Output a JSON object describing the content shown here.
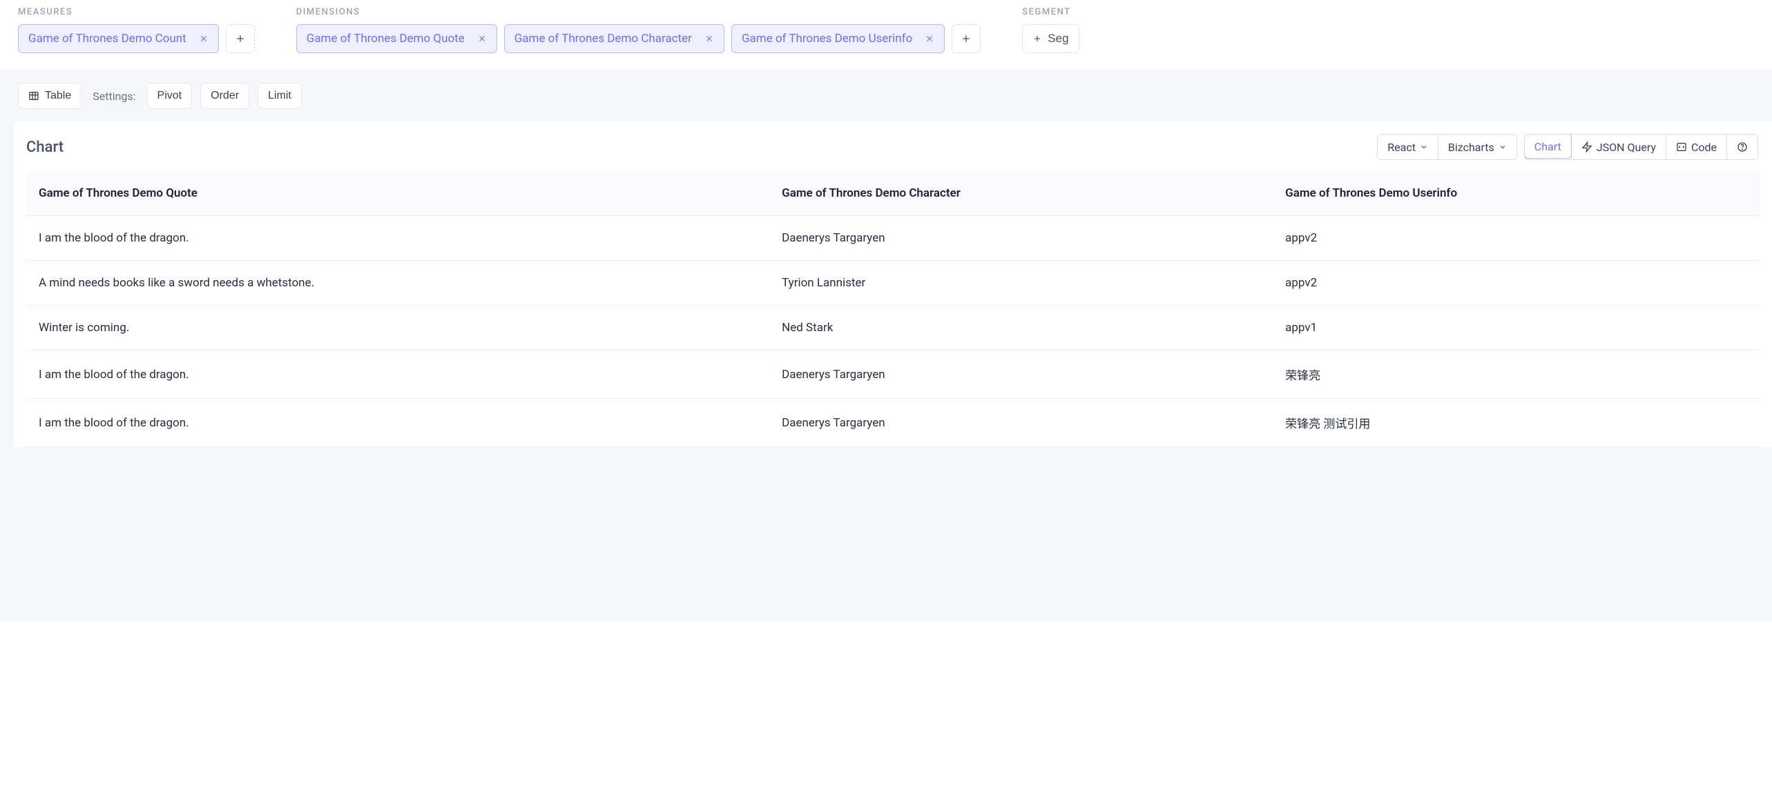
{
  "measures": {
    "label": "MEASURES",
    "chips": [
      "Game of Thrones Demo Count"
    ]
  },
  "dimensions": {
    "label": "DIMENSIONS",
    "chips": [
      "Game of Thrones Demo Quote",
      "Game of Thrones Demo Character",
      "Game of Thrones Demo Userinfo"
    ]
  },
  "segment": {
    "label": "SEGMENT",
    "add_label": "Seg"
  },
  "toolbar": {
    "table": "Table",
    "settings_label": "Settings:",
    "pivot": "Pivot",
    "order": "Order",
    "limit": "Limit"
  },
  "panel": {
    "title": "Chart",
    "framework": "React",
    "chartlib": "Bizcharts",
    "view_chart": "Chart",
    "view_json": "JSON Query",
    "view_code": "Code"
  },
  "table": {
    "headers": [
      "Game of Thrones Demo Quote",
      "Game of Thrones Demo Character",
      "Game of Thrones Demo Userinfo"
    ],
    "rows": [
      [
        "I am the blood of the dragon.",
        "Daenerys Targaryen",
        "appv2"
      ],
      [
        "A mind needs books like a sword needs a whetstone.",
        "Tyrion Lannister",
        "appv2"
      ],
      [
        "Winter is coming.",
        "Ned Stark",
        "appv1"
      ],
      [
        "I am the blood of the dragon.",
        "Daenerys Targaryen",
        "荣锋亮"
      ],
      [
        "I am the blood of the dragon.",
        "Daenerys Targaryen",
        "荣锋亮 测试引用"
      ]
    ]
  }
}
